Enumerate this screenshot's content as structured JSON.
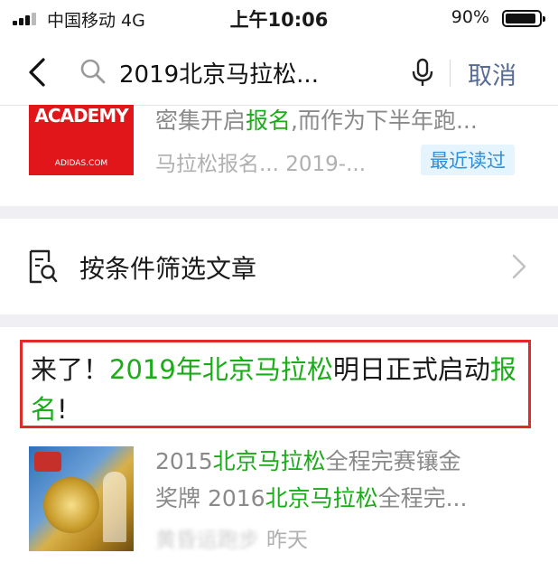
{
  "status_bar": {
    "carrier": "中国移动  4G",
    "time": "上午10:06",
    "battery_percent": "90%",
    "battery_level": 0.9
  },
  "search": {
    "query": "2019北京马拉松...",
    "cancel_label": "取消"
  },
  "card1": {
    "thumb_brand": "ACADEMY",
    "thumb_footer": "ADIDAS.COM",
    "snippet_before": "密集开启",
    "snippet_highlight": "报名",
    "snippet_after": ",而作为下半年跑...",
    "meta": "马拉松报名...   2019-...",
    "badge": "最近读过"
  },
  "filter": {
    "label": "按条件筛选文章"
  },
  "result": {
    "title_p1": "来了！",
    "title_p2": "2019年北京马拉松",
    "title_p3": "明日正式启动",
    "title_p4": "报名",
    "title_p5": "!",
    "desc_l1_a": "2015",
    "desc_l1_b": "北京马拉松",
    "desc_l1_c": "全程完赛镶金",
    "desc_l2_a": "奖牌 2016",
    "desc_l2_b": "北京马拉松",
    "desc_l2_c": "全程完...",
    "source": "黄昏运跑步",
    "date": "昨天"
  },
  "colors": {
    "highlight": "#1aad19",
    "link": "#576b95",
    "box_border": "#e12b2b",
    "badge_bg": "#e6f4fe"
  },
  "icons": [
    "signal-icon",
    "battery-icon",
    "back-icon",
    "search-icon",
    "mic-icon",
    "filter-doc-icon",
    "chevron-right-icon"
  ]
}
